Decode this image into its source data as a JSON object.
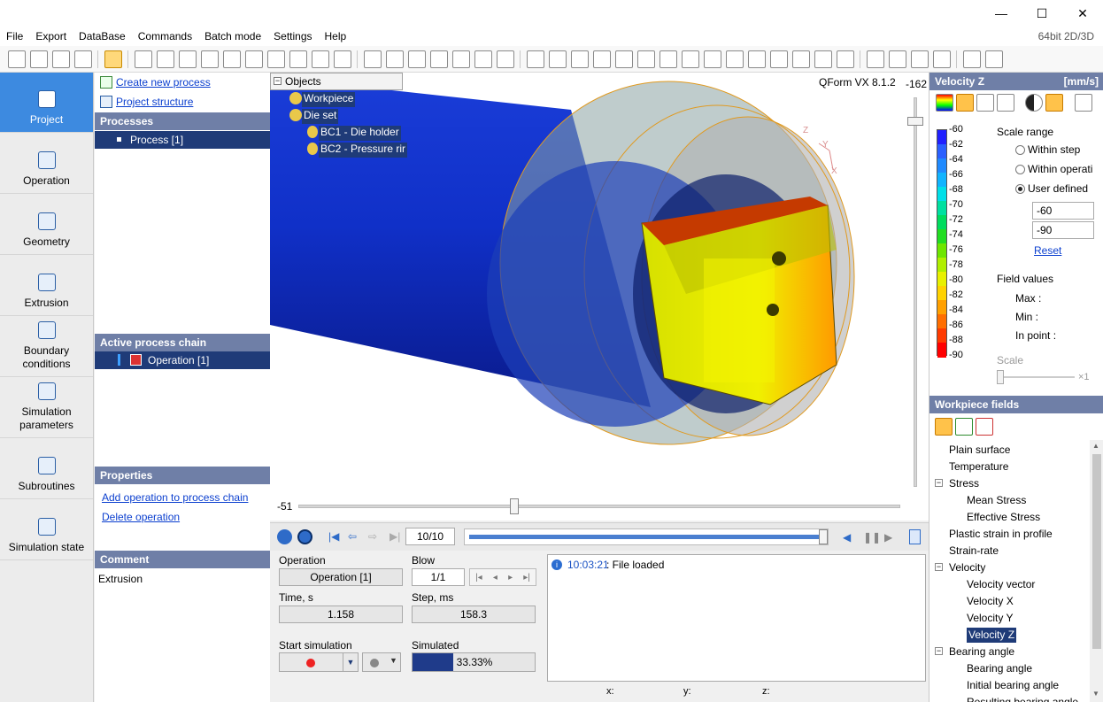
{
  "window": {
    "minimize": "—",
    "maximize": "☐",
    "close": "✕"
  },
  "menu": {
    "items": [
      "File",
      "Export",
      "DataBase",
      "Commands",
      "Batch mode",
      "Settings",
      "Help"
    ],
    "right_text": "64bit 2D/3D"
  },
  "toolbar": {
    "icons": [
      "new-icon",
      "open-icon",
      "save-icon",
      "tree-icon",
      "pointer-icon",
      "fit-icon",
      "rotate3d-icon",
      "box-icon",
      "zoom-in-icon",
      "zoom-out-icon",
      "zoom-window-icon",
      "pan-icon",
      "rotate-cw-icon",
      "rotate-ccw-icon",
      "brush-icon",
      "curve-icon",
      "eye-icon",
      "eye-all-icon",
      "cube-icon",
      "cylinder-icon",
      "solid-icon",
      "view3d-icon",
      "mesh-icon",
      "mesh2-icon",
      "grid-icon",
      "axis-xy-icon",
      "axis-xz-icon",
      "axis-yz-icon",
      "axis-yx-icon",
      "axis-zx-icon",
      "axis-zy-icon",
      "axis-n-icon",
      "ruler-icon",
      "measure-icon",
      "angle-icon",
      "section-icon",
      "gear-icon",
      "envelope-icon",
      "envelope2-icon",
      "flip-icon",
      "exchange-icon",
      "report-icon",
      "report2-icon"
    ]
  },
  "leftnav": [
    {
      "id": "project",
      "label": "Project",
      "icon": "project-icon"
    },
    {
      "id": "operation",
      "label": "Operation",
      "icon": "down-arrow-icon"
    },
    {
      "id": "geometry",
      "label": "Geometry",
      "icon": "geometry-icon"
    },
    {
      "id": "extrusion",
      "label": "Extrusion",
      "icon": "extrusion-icon"
    },
    {
      "id": "boundary",
      "label": "Boundary conditions",
      "icon": "boundary-icon"
    },
    {
      "id": "simparams",
      "label": "Simulation parameters",
      "icon": "params-icon"
    },
    {
      "id": "subroutines",
      "label": "Subroutines",
      "icon": "fx-icon"
    },
    {
      "id": "simstate",
      "label": "Simulation state",
      "icon": "state-icon"
    }
  ],
  "project": {
    "create_new": "Create new process",
    "structure": "Project structure",
    "processes_header": "Processes",
    "process_item": "Process [1]",
    "chain_header": "Active process chain",
    "chain_item": "Operation [1]",
    "properties_header": "Properties",
    "add_op": "Add operation to process chain",
    "delete_op": "Delete operation",
    "comment_header": "Comment",
    "comment_text": "Extrusion"
  },
  "objects_tree": {
    "header": "Objects",
    "workpiece": "Workpiece",
    "dieset": "Die set",
    "bc1": "BC1 - Die holder",
    "bc2": "BC2 - Pressure rir"
  },
  "viewport": {
    "version": "QForm VX 8.1.2",
    "axis_z": "Z",
    "axis_y": "Y",
    "axis_x": "X"
  },
  "sliders": {
    "vertical_value": "-162",
    "horizontal_value": "-51"
  },
  "playback": {
    "counter": "10/10",
    "progress": 1.0
  },
  "info": {
    "operation_label": "Operation",
    "operation_value": "Operation [1]",
    "blow_label": "Blow",
    "blow_value": "1/1",
    "time_label": "Time, s",
    "time_value": "1.158",
    "step_label": "Step, ms",
    "step_value": "158.3",
    "start_label": "Start simulation",
    "simulated_label": "Simulated",
    "simulated_value": "33.33%",
    "simulated_fraction": 0.3333
  },
  "log": {
    "time": "10:03:21",
    "message": ": File loaded"
  },
  "status": {
    "x": "x:",
    "y": "y:",
    "z": "z:"
  },
  "velocity": {
    "header": "Velocity Z",
    "unit": "[mm/s]",
    "scale_values": [
      "-60",
      "-62",
      "-64",
      "-66",
      "-68",
      "-70",
      "-72",
      "-74",
      "-76",
      "-78",
      "-80",
      "-82",
      "-84",
      "-86",
      "-88",
      "-90"
    ],
    "scale_colors": [
      "#2020ff",
      "#2a60ff",
      "#1f8aff",
      "#10b4ff",
      "#00dfe8",
      "#00e0a0",
      "#00dc5e",
      "#22dd22",
      "#6ee600",
      "#b0ef00",
      "#e8f000",
      "#ffd200",
      "#ffa000",
      "#ff6e00",
      "#ff3a00",
      "#ff0000"
    ],
    "scale_range_label": "Scale range",
    "within_step": "Within step",
    "within_operation": "Within operati",
    "user_defined": "User defined",
    "max_input": "-60",
    "min_input": "-90",
    "reset": "Reset",
    "field_values": "Field values",
    "max_label": "Max :",
    "min_label": "Min :",
    "in_point": "In point :",
    "scale_label": "Scale",
    "scale_mult": "×1"
  },
  "workpiece_fields": {
    "header": "Workpiece fields",
    "items": [
      {
        "label": "Plain surface",
        "level": 0
      },
      {
        "label": "Temperature",
        "level": 0
      },
      {
        "label": "Stress",
        "level": 0,
        "expand": "−"
      },
      {
        "label": "Mean Stress",
        "level": 1
      },
      {
        "label": "Effective Stress",
        "level": 1
      },
      {
        "label": "Plastic strain in profile",
        "level": 0
      },
      {
        "label": "Strain-rate",
        "level": 0
      },
      {
        "label": "Velocity",
        "level": 0,
        "expand": "−"
      },
      {
        "label": "Velocity vector",
        "level": 1
      },
      {
        "label": "Velocity X",
        "level": 1
      },
      {
        "label": "Velocity Y",
        "level": 1
      },
      {
        "label": "Velocity Z",
        "level": 1,
        "selected": true
      },
      {
        "label": "Bearing angle",
        "level": 0,
        "expand": "−"
      },
      {
        "label": "Bearing angle",
        "level": 1
      },
      {
        "label": "Initial bearing angle",
        "level": 1
      },
      {
        "label": "Resulting bearing angle",
        "level": 1
      }
    ]
  }
}
